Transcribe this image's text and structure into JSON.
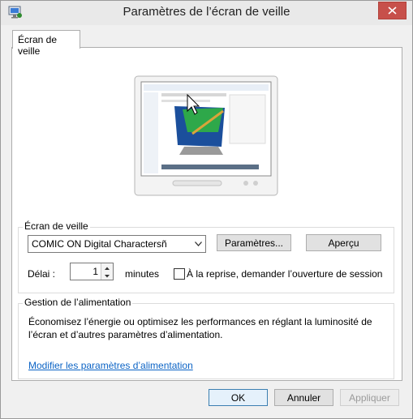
{
  "window": {
    "title": "Paramètres de l’écran de veille",
    "icon": "monitor-settings-icon"
  },
  "tabs": [
    {
      "label": "Écran de veille",
      "selected": true
    }
  ],
  "screensaver": {
    "group_label": "Écran de veille",
    "selected": "COMIC ON Digital Charactersñ",
    "settings_label": "Paramètres...",
    "preview_label": "Aperçu",
    "delay_label": "Délai :",
    "delay_value": "1",
    "minutes_label": "minutes",
    "resume_checkbox_label": "À la reprise, demander l’ouverture de session",
    "resume_checked": false
  },
  "power": {
    "group_label": "Gestion de l’alimentation",
    "description": "Économisez l’énergie ou optimisez les performances en réglant la luminosité de l’écran et d’autres paramètres d’alimentation.",
    "link": "Modifier les paramètres d’alimentation"
  },
  "footer": {
    "ok_label": "OK",
    "cancel_label": "Annuler",
    "apply_label": "Appliquer",
    "apply_enabled": false
  },
  "colors": {
    "close_button": "#c7504a",
    "link": "#0b63c5",
    "default_button_border": "#3c7fb1"
  }
}
